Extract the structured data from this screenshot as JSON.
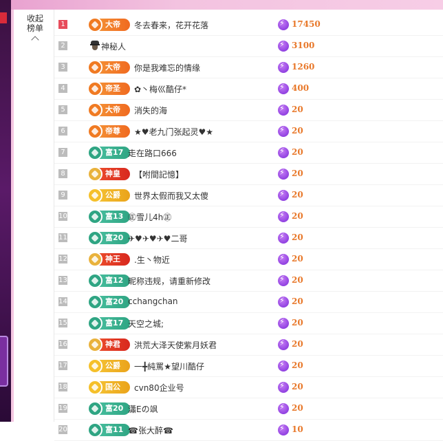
{
  "panel": {
    "collapse_label": "收起榜单"
  },
  "ranking": [
    {
      "rank": "1",
      "badge": "大帝",
      "badge_style": "orange",
      "name": "冬去春来，花开花落",
      "score": "17450"
    },
    {
      "rank": "2",
      "badge": "",
      "badge_style": "mystery",
      "name": "神秘人",
      "score": "3100"
    },
    {
      "rank": "3",
      "badge": "大帝",
      "badge_style": "orange",
      "name": "你是我难忘的情缘",
      "score": "1260"
    },
    {
      "rank": "4",
      "badge": "帝圣",
      "badge_style": "orange",
      "name": "✿丶梅巛酷仔*",
      "score": "400"
    },
    {
      "rank": "5",
      "badge": "大帝",
      "badge_style": "orange",
      "name": "消失的海",
      "score": "20"
    },
    {
      "rank": "6",
      "badge": "帝尊",
      "badge_style": "orange",
      "name": "★♥老九门张起灵♥★",
      "score": "20"
    },
    {
      "rank": "7",
      "badge": "富17",
      "badge_style": "teal",
      "name": "走在路口666",
      "score": "20"
    },
    {
      "rank": "8",
      "badge": "神皇",
      "badge_style": "red",
      "name": "【咐間記憶】",
      "score": "20"
    },
    {
      "rank": "9",
      "badge": "公爵",
      "badge_style": "gold",
      "name": "世界太假而我又太傻",
      "score": "20"
    },
    {
      "rank": "10",
      "badge": "富13",
      "badge_style": "teal",
      "name": "㊣雪儿4h㊣",
      "score": "20"
    },
    {
      "rank": "11",
      "badge": "富20",
      "badge_style": "teal",
      "name": "✈♥✈♥✈♥二哥",
      "score": "20"
    },
    {
      "rank": "12",
      "badge": "神王",
      "badge_style": "red",
      "name": ".生丶物近",
      "score": "20"
    },
    {
      "rank": "13",
      "badge": "富12",
      "badge_style": "teal",
      "name": "昵称违规，请重新修改",
      "score": "20"
    },
    {
      "rank": "14",
      "badge": "富20",
      "badge_style": "teal",
      "name": "cchangchan",
      "score": "20"
    },
    {
      "rank": "15",
      "badge": "富17",
      "badge_style": "teal",
      "name": "天空之城;",
      "score": "20"
    },
    {
      "rank": "16",
      "badge": "神君",
      "badge_style": "red",
      "name": "洪荒大泽天使紫月妖君",
      "score": "20"
    },
    {
      "rank": "17",
      "badge": "公爵",
      "badge_style": "gold",
      "name": "一╋純罵★望川酷仔",
      "score": "20"
    },
    {
      "rank": "18",
      "badge": "国公",
      "badge_style": "gold",
      "name": "cvn80企业号",
      "score": "20"
    },
    {
      "rank": "19",
      "badge": "富20",
      "badge_style": "teal",
      "name": "瀟Eの飒",
      "score": "20"
    },
    {
      "rank": "20",
      "badge": "富11",
      "badge_style": "teal",
      "name": "☎张大醉☎",
      "score": "10"
    }
  ]
}
